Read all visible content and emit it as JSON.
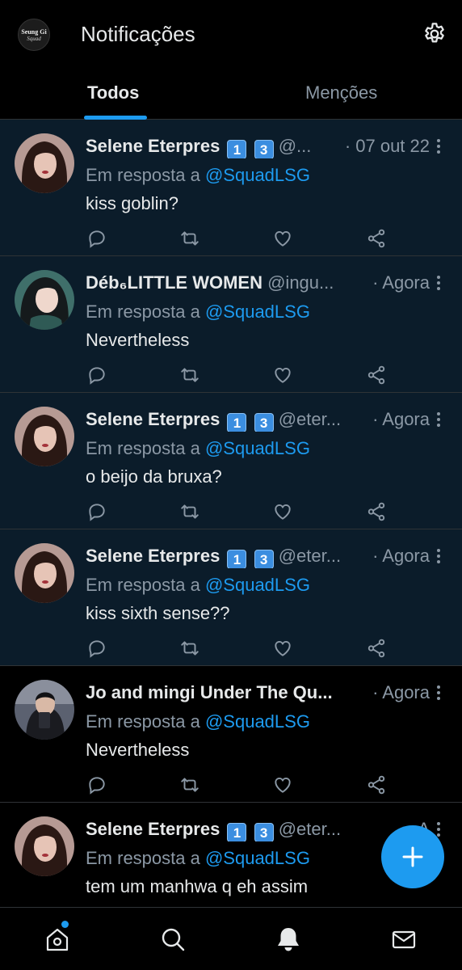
{
  "header": {
    "logo_line1": "Seung Gi",
    "logo_line2": "Squad",
    "title": "Notificações"
  },
  "tabs": [
    {
      "label": "Todos",
      "active": true
    },
    {
      "label": "Menções",
      "active": false
    }
  ],
  "notifications": [
    {
      "name": "Selene Eterpres",
      "badges": [
        "1",
        "3"
      ],
      "handle": "@...",
      "time": "· 07 out 22",
      "reply_prefix": "Em resposta a",
      "reply_to": "@SquadLSG",
      "text": "kiss goblin?",
      "unread": true
    },
    {
      "name": "Déb₆LITTLE WOMEN",
      "badges": [],
      "handle": "@ingu...",
      "time": "· Agora",
      "reply_prefix": "Em resposta a",
      "reply_to": "@SquadLSG",
      "text": "Nevertheless",
      "unread": true
    },
    {
      "name": "Selene Eterpres",
      "badges": [
        "1",
        "3"
      ],
      "handle": "@eter...",
      "time": "· Agora",
      "reply_prefix": "Em resposta a",
      "reply_to": "@SquadLSG",
      "text": "o beijo da bruxa?",
      "unread": true
    },
    {
      "name": "Selene Eterpres",
      "badges": [
        "1",
        "3"
      ],
      "handle": "@eter...",
      "time": "· Agora",
      "reply_prefix": "Em resposta a",
      "reply_to": "@SquadLSG",
      "text": "kiss sixth sense??",
      "unread": true
    },
    {
      "name": "Jo and mingi Under The Qu...",
      "badges": [],
      "handle": "",
      "time": "· Agora",
      "reply_prefix": "Em resposta a",
      "reply_to": "@SquadLSG",
      "text": "Nevertheless",
      "unread": false
    },
    {
      "name": "Selene Eterpres",
      "badges": [
        "1",
        "3"
      ],
      "handle": "@eter...",
      "time": "· A",
      "reply_prefix": "Em resposta a",
      "reply_to": "@SquadLSG",
      "text": "tem um manhwa q eh assim",
      "unread": false
    }
  ],
  "icons": {
    "settings": "gear-icon",
    "more": "more-vertical-icon",
    "reply": "reply-icon",
    "retweet": "retweet-icon",
    "like": "heart-icon",
    "share": "share-icon",
    "compose": "plus-icon",
    "home": "home-icon",
    "search": "search-icon",
    "notifications": "bell-icon",
    "messages": "mail-icon"
  },
  "colors": {
    "accent": "#1d9bf0",
    "unread_bg": "#0b1c2a",
    "muted_text": "#8b98a5"
  }
}
